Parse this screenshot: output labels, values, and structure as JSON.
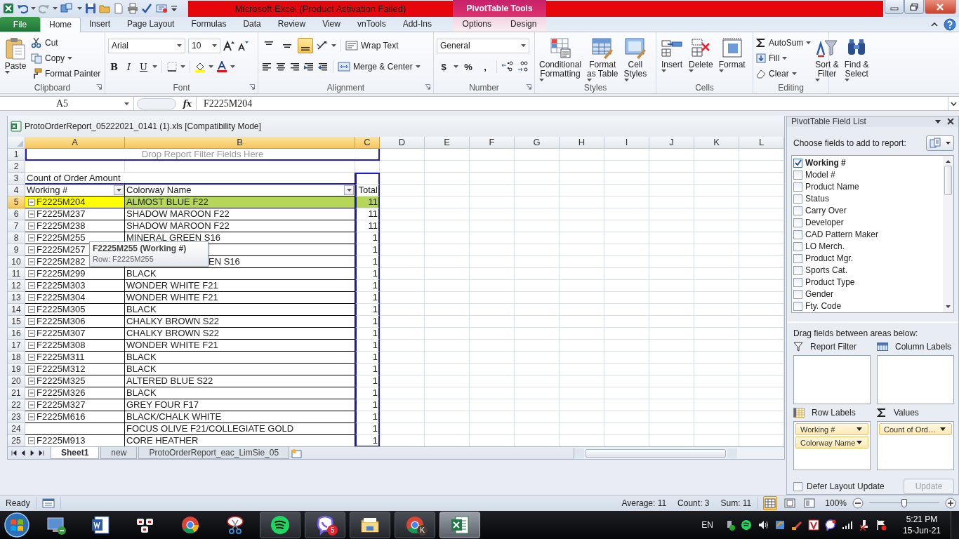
{
  "title_bar": {
    "title": "Microsoft Excel (Product Activation Failed)",
    "context_title": "PivotTable Tools"
  },
  "ribbon_tabs": [
    {
      "label": "File",
      "kind": "file",
      "selected": false
    },
    {
      "label": "Home",
      "kind": "normal",
      "selected": true
    },
    {
      "label": "Insert",
      "kind": "normal",
      "selected": false
    },
    {
      "label": "Page Layout",
      "kind": "normal",
      "selected": false
    },
    {
      "label": "Formulas",
      "kind": "normal",
      "selected": false
    },
    {
      "label": "Data",
      "kind": "normal",
      "selected": false
    },
    {
      "label": "Review",
      "kind": "normal",
      "selected": false
    },
    {
      "label": "View",
      "kind": "normal",
      "selected": false
    },
    {
      "label": "vnTools",
      "kind": "normal",
      "selected": false
    },
    {
      "label": "Add-Ins",
      "kind": "normal",
      "selected": false
    },
    {
      "label": "Options",
      "kind": "context",
      "selected": false
    },
    {
      "label": "Design",
      "kind": "context",
      "selected": false
    }
  ],
  "ribbon": {
    "groups": [
      {
        "kind": "clipboard",
        "label": "Clipboard",
        "launcher": true,
        "paste": "Paste",
        "items": [
          {
            "kind": "cut",
            "label": "Cut",
            "menu": false
          },
          {
            "kind": "copy",
            "label": "Copy",
            "menu": true
          },
          {
            "kind": "painter",
            "label": "Format Painter",
            "menu": false
          }
        ]
      },
      {
        "kind": "font",
        "label": "Font",
        "launcher": true,
        "font_name": "Arial",
        "font_size": "10",
        "style_buttons": [
          "B",
          "I",
          "U"
        ]
      },
      {
        "kind": "alignment",
        "label": "Alignment",
        "launcher": true,
        "align_top": false,
        "align_middle": false,
        "align_bottom": true,
        "wrap": "Wrap Text",
        "merge": "Merge & Center"
      },
      {
        "kind": "number",
        "label": "Number",
        "launcher": true,
        "format": "General",
        "symbols": [
          "$",
          "%",
          ","
        ]
      },
      {
        "kind": "styles",
        "label": "Styles",
        "launcher": false,
        "buttons": [
          {
            "kind": "conditional",
            "lines": [
              "Conditional",
              "Formatting"
            ]
          },
          {
            "kind": "table",
            "lines": [
              "Format",
              "as Table"
            ]
          },
          {
            "kind": "cellstyles",
            "lines": [
              "Cell",
              "Styles"
            ]
          }
        ]
      },
      {
        "kind": "cells",
        "label": "Cells",
        "launcher": false,
        "buttons": [
          {
            "kind": "insert",
            "lines": [
              "Insert"
            ]
          },
          {
            "kind": "delete",
            "lines": [
              "Delete"
            ]
          },
          {
            "kind": "format",
            "lines": [
              "Format"
            ]
          }
        ]
      },
      {
        "kind": "editing",
        "label": "Editing",
        "launcher": false,
        "items": [
          {
            "kind": "autosum",
            "label": "AutoSum"
          },
          {
            "kind": "fill",
            "label": "Fill"
          },
          {
            "kind": "clear",
            "label": "Clear"
          }
        ],
        "buttons": [
          {
            "kind": "sort",
            "lines": [
              "Sort &",
              "Filter"
            ]
          },
          {
            "kind": "find",
            "lines": [
              "Find &",
              "Select"
            ]
          }
        ]
      }
    ]
  },
  "formula_bar": {
    "name_box": "A5",
    "function_symbol": "fx",
    "value": "F2225M204"
  },
  "workbook": {
    "title": "ProtoOrderReport_05222021_0141 (1).xls  [Compatibility Mode]",
    "columns": [
      {
        "label": "A",
        "selected": true
      },
      {
        "label": "B",
        "selected": true
      },
      {
        "label": "C",
        "selected": true
      },
      {
        "label": "D",
        "selected": false
      },
      {
        "label": "E",
        "selected": false
      },
      {
        "label": "F",
        "selected": false
      },
      {
        "label": "G",
        "selected": false
      },
      {
        "label": "H",
        "selected": false
      },
      {
        "label": "I",
        "selected": false
      },
      {
        "label": "J",
        "selected": false
      },
      {
        "label": "K",
        "selected": false
      },
      {
        "label": "L",
        "selected": false
      }
    ],
    "rows": [
      {
        "row": "1",
        "kind": "filter",
        "selected": false,
        "text": "Drop Report Filter Fields Here"
      },
      {
        "row": "2",
        "kind": "blank",
        "selected": false
      },
      {
        "row": "3",
        "kind": "caption",
        "selected": false,
        "text": "Count of Order Amount"
      },
      {
        "row": "4",
        "kind": "header",
        "selected": false,
        "working": "Working #",
        "colorway": "Colorway Name",
        "total": "Total"
      },
      {
        "row": "5",
        "kind": "data",
        "selected": true,
        "collapsible": true,
        "working": "F2225M204",
        "colorway": "ALMOST BLUE F22",
        "total": "11"
      },
      {
        "row": "6",
        "kind": "data",
        "selected": false,
        "collapsible": true,
        "working": "F2225M237",
        "colorway": "SHADOW MAROON F22",
        "total": "11"
      },
      {
        "row": "7",
        "kind": "data",
        "selected": false,
        "collapsible": true,
        "working": "F2225M238",
        "colorway": "SHADOW MAROON F22",
        "total": "11"
      },
      {
        "row": "8",
        "kind": "data",
        "selected": false,
        "collapsible": true,
        "working": "F2225M255",
        "colorway": "MINERAL GREEN S16",
        "total": "1"
      },
      {
        "row": "9",
        "kind": "data",
        "selected": false,
        "collapsible": true,
        "covered": true,
        "working": "F2225M257",
        "total": "1"
      },
      {
        "row": "10",
        "kind": "data",
        "selected": false,
        "collapsible": true,
        "covered": true,
        "working": "F2225M282",
        "colorway": "EN S16",
        "total": "1"
      },
      {
        "row": "11",
        "kind": "data",
        "selected": false,
        "collapsible": true,
        "working": "F2225M299",
        "colorway": "BLACK",
        "total": "1"
      },
      {
        "row": "12",
        "kind": "data",
        "selected": false,
        "collapsible": true,
        "working": "F2225M303",
        "colorway": "WONDER WHITE F21",
        "total": "1"
      },
      {
        "row": "13",
        "kind": "data",
        "selected": false,
        "collapsible": true,
        "working": "F2225M304",
        "colorway": "WONDER WHITE F21",
        "total": "1"
      },
      {
        "row": "14",
        "kind": "data",
        "selected": false,
        "collapsible": true,
        "working": "F2225M305",
        "colorway": "BLACK",
        "total": "1"
      },
      {
        "row": "15",
        "kind": "data",
        "selected": false,
        "collapsible": true,
        "working": "F2225M306",
        "colorway": "CHALKY BROWN S22",
        "total": "1"
      },
      {
        "row": "16",
        "kind": "data",
        "selected": false,
        "collapsible": true,
        "working": "F2225M307",
        "colorway": "CHALKY BROWN S22",
        "total": "1"
      },
      {
        "row": "17",
        "kind": "data",
        "selected": false,
        "collapsible": true,
        "working": "F2225M308",
        "colorway": "WONDER WHITE F21",
        "total": "1"
      },
      {
        "row": "18",
        "kind": "data",
        "selected": false,
        "collapsible": true,
        "working": "F2225M311",
        "colorway": "BLACK",
        "total": "1"
      },
      {
        "row": "19",
        "kind": "data",
        "selected": false,
        "collapsible": true,
        "working": "F2225M312",
        "colorway": "BLACK",
        "total": "1"
      },
      {
        "row": "20",
        "kind": "data",
        "selected": false,
        "collapsible": true,
        "working": "F2225M325",
        "colorway": "ALTERED BLUE S22",
        "total": "1"
      },
      {
        "row": "21",
        "kind": "data",
        "selected": false,
        "collapsible": true,
        "working": "F2225M326",
        "colorway": "BLACK",
        "total": "1"
      },
      {
        "row": "22",
        "kind": "data",
        "selected": false,
        "collapsible": true,
        "working": "F2225M327",
        "colorway": "GREY FOUR F17",
        "total": "1"
      },
      {
        "row": "23",
        "kind": "data",
        "selected": false,
        "collapsible": true,
        "working": "F2225M616",
        "colorway": "BLACK/CHALK WHITE",
        "total": "1"
      },
      {
        "row": "24",
        "kind": "data",
        "selected": false,
        "collapsible": false,
        "colorway": "FOCUS OLIVE F21/COLLEGIATE GOLD",
        "total": "1"
      },
      {
        "row": "25",
        "kind": "data",
        "selected": false,
        "collapsible": true,
        "working": "F2225M913",
        "colorway": "CORE HEATHER",
        "total": "1"
      }
    ],
    "tooltip": {
      "title": "F2225M255 (Working #)",
      "detail": "Row: F2225M255"
    },
    "sheet_tabs": [
      {
        "label": "Sheet1",
        "selected": true
      },
      {
        "label": "new",
        "selected": false
      },
      {
        "label": "ProtoOrderReport_eac_LimSie_05",
        "selected": false
      }
    ]
  },
  "field_list": {
    "title": "PivotTable Field List",
    "prompt": "Choose fields to add to report:",
    "fields": [
      {
        "label": "Working #",
        "checked": true
      },
      {
        "label": "Model #",
        "checked": false
      },
      {
        "label": "Product Name",
        "checked": false
      },
      {
        "label": "Status",
        "checked": false
      },
      {
        "label": "Carry Over",
        "checked": false
      },
      {
        "label": "Developer",
        "checked": false
      },
      {
        "label": "CAD Pattern Maker",
        "checked": false
      },
      {
        "label": "LO Merch.",
        "checked": false
      },
      {
        "label": "Product Mgr.",
        "checked": false
      },
      {
        "label": "Sports Cat.",
        "checked": false
      },
      {
        "label": "Product Type",
        "checked": false
      },
      {
        "label": "Gender",
        "checked": false
      },
      {
        "label": "Fty. Code",
        "checked": false
      }
    ],
    "areas_prompt": "Drag fields between areas below:",
    "areas": [
      {
        "kind": "filter",
        "label": "Report Filter"
      },
      {
        "kind": "columns",
        "label": "Column Labels"
      },
      {
        "kind": "rows",
        "label": "Row Labels",
        "items": [
          "Working #",
          "Colorway Name"
        ]
      },
      {
        "kind": "values",
        "label": "Values",
        "items": [
          "Count of Ord…"
        ]
      }
    ],
    "defer": {
      "label": "Defer Layout Update",
      "checked": false
    },
    "update_button": {
      "label": "Update",
      "disabled": true
    }
  },
  "status_bar": {
    "mode": "Ready",
    "stats": [
      "Average: 11",
      "Count: 3",
      "Sum: 11"
    ],
    "views": [
      {
        "kind": "normal",
        "selected": true
      },
      {
        "kind": "layout",
        "selected": false
      },
      {
        "kind": "preview",
        "selected": false
      }
    ],
    "zoom": "100%",
    "zoom_slider": {
      "level": 0.5
    }
  },
  "taskbar": {
    "apps": [
      {
        "kind": "remote",
        "running": false,
        "active": false
      },
      {
        "kind": "word",
        "running": false,
        "active": false
      },
      {
        "kind": "keys",
        "running": false,
        "active": false
      },
      {
        "kind": "chrome",
        "running": false,
        "active": false
      },
      {
        "kind": "snip",
        "running": false,
        "active": false
      },
      {
        "kind": "spotify",
        "running": true,
        "active": false
      },
      {
        "kind": "viber",
        "running": true,
        "active": false,
        "badge": "5"
      },
      {
        "kind": "explorer",
        "running": true,
        "active": false
      },
      {
        "kind": "chrome",
        "running": true,
        "active": false,
        "badge": "K"
      },
      {
        "kind": "excel",
        "running": true,
        "active": true
      }
    ],
    "language": "EN",
    "time": "5:21 PM",
    "date": "15-Jun-21"
  }
}
